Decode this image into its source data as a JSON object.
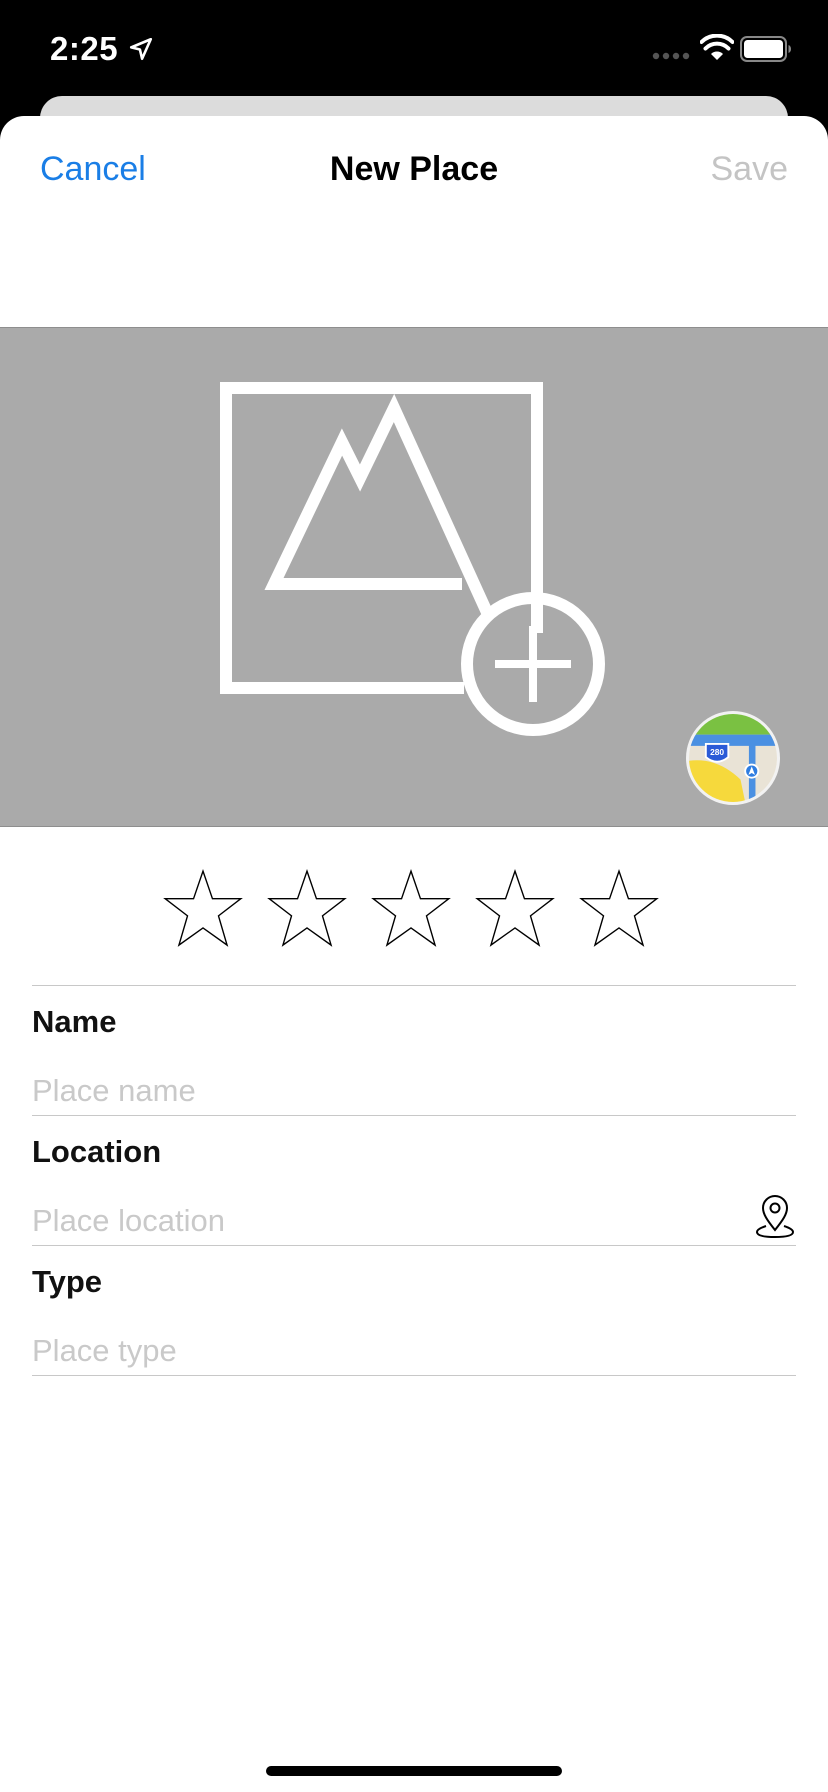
{
  "status_bar": {
    "time": "2:25",
    "icons": [
      "location-arrow-icon",
      "cellular-signal-icon",
      "wifi-icon",
      "battery-icon"
    ]
  },
  "nav": {
    "cancel_label": "Cancel",
    "title": "New Place",
    "save_label": "Save",
    "colors": {
      "accent": "#1a7ee6",
      "disabled": "#c4c4c4"
    }
  },
  "image_picker": {
    "background_color": "#aaaaaa",
    "icon": "add-photo-icon",
    "maps_icon": "maps-app-icon",
    "maps_shield_text": "280"
  },
  "rating": {
    "max": 5,
    "value": 0,
    "icon": "star-outline-icon"
  },
  "form": {
    "name": {
      "label": "Name",
      "placeholder": "Place name",
      "value": ""
    },
    "location": {
      "label": "Location",
      "placeholder": "Place location",
      "value": "",
      "icon": "map-pin-icon"
    },
    "type": {
      "label": "Type",
      "placeholder": "Place type",
      "value": ""
    }
  }
}
